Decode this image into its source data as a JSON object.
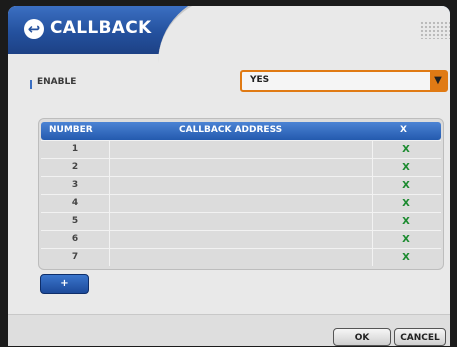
{
  "window": {
    "title": "CALLBACK",
    "title_icon": "back-arrow-icon"
  },
  "enable": {
    "label": "ENABLE",
    "selected_value": "YES",
    "arrow_glyph": "▼"
  },
  "table": {
    "headers": {
      "number": "NUMBER",
      "address": "CALLBACK ADDRESS",
      "delete": "X"
    },
    "rows": [
      {
        "number": "1",
        "address": "",
        "delete": "X"
      },
      {
        "number": "2",
        "address": "",
        "delete": "X"
      },
      {
        "number": "3",
        "address": "",
        "delete": "X"
      },
      {
        "number": "4",
        "address": "",
        "delete": "X"
      },
      {
        "number": "5",
        "address": "",
        "delete": "X"
      },
      {
        "number": "6",
        "address": "",
        "delete": "X"
      },
      {
        "number": "7",
        "address": "",
        "delete": "X"
      }
    ]
  },
  "add_button_label": "+",
  "buttons": {
    "ok": "OK",
    "cancel": "CANCEL"
  },
  "colors": {
    "titlebar": "#24519e",
    "accent_orange": "#e07a14",
    "delete_green": "#1a8a2e"
  }
}
